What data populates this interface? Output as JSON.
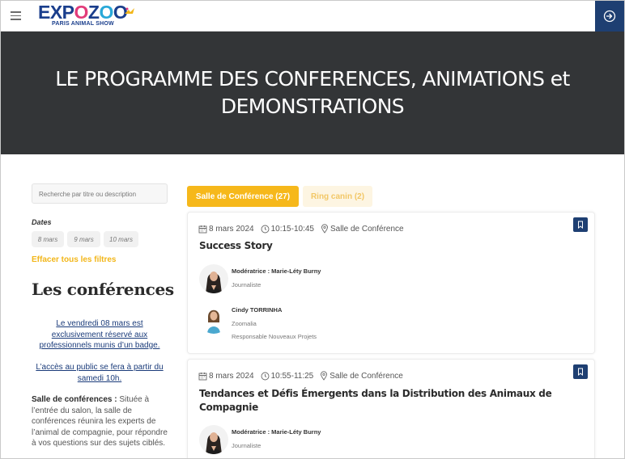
{
  "header": {
    "logo_text": "EXPOZOO",
    "logo_subtitle": "PARIS ANIMAL SHOW",
    "menu_icon": "hamburger-icon",
    "login_icon": "sign-in-icon",
    "login_bg_color": "#1e3f72"
  },
  "hero": {
    "title": "LE PROGRAMME DES CONFERENCES, ANIMATIONS et DEMONSTRATIONS",
    "bg_color": "#333537"
  },
  "filters": {
    "search_placeholder": "Recherche par titre ou description",
    "dates_label": "Dates",
    "date_options": [
      "8 mars",
      "9 mars",
      "10 mars"
    ],
    "clear_label": "Effacer tous les filtres"
  },
  "sidebar": {
    "section_title": "Les conférences",
    "notice_1": "Le vendredi 08 mars est exclusivement réservé aux professionnels munis d’un badge.",
    "notice_2": "L’accès au public se fera à partir du samedi 10h.",
    "description_bold": "Salle de conférences :",
    "description_text": " Située à l’entrée du salon, la salle de conférences réunira les experts de l’animal de compagnie, pour répondre à vos questions sur des sujets ciblés."
  },
  "tabs": [
    {
      "label": "Salle de Conférence (27)",
      "active": true
    },
    {
      "label": "Ring canin (2)",
      "active": false
    }
  ],
  "accent_color": "#f6b81b",
  "events": [
    {
      "date": "8 mars 2024",
      "time": "10:15-10:45",
      "location": "Salle de Conférence",
      "title": "Success Story",
      "people": [
        {
          "name": "Modératrice : Marie-Léty Burny",
          "line1": "Journaliste",
          "line2": ""
        },
        {
          "name": "Cindy TORRINHA",
          "line1": "Zoomalia",
          "line2": "Responsable Nouveaux Projets"
        }
      ]
    },
    {
      "date": "8 mars 2024",
      "time": "10:55-11:25",
      "location": "Salle de Conférence",
      "title": "Tendances et Défis Émergents dans la Distribution des Animaux de Compagnie",
      "people": [
        {
          "name": "Modératrice : Marie-Léty Burny",
          "line1": "Journaliste",
          "line2": ""
        }
      ]
    }
  ]
}
